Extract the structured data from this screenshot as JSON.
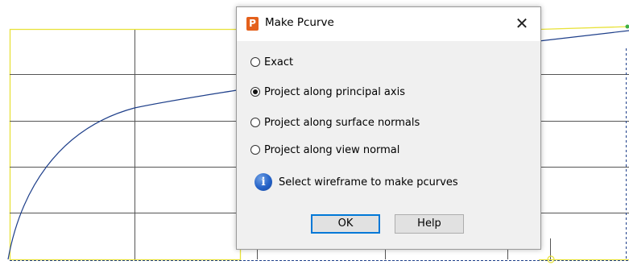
{
  "dialog": {
    "app_icon_letter": "P",
    "title": "Make Pcurve",
    "close_symbol": "✕",
    "options": [
      {
        "label": "Exact",
        "selected": false
      },
      {
        "label": "Project along principal axis",
        "selected": true
      },
      {
        "label": "Project along surface normals",
        "selected": false
      },
      {
        "label": "Project along view normal",
        "selected": false
      }
    ],
    "info_icon_glyph": "i",
    "info_message": "Select wireframe to make pcurves",
    "ok_label": "OK",
    "help_label": "Help"
  },
  "colors": {
    "wireframe_yellow": "#e8e23a",
    "curve_blue": "#1e3f8a",
    "grid_dark": "#555555",
    "accent_orange": "#e4601b"
  }
}
